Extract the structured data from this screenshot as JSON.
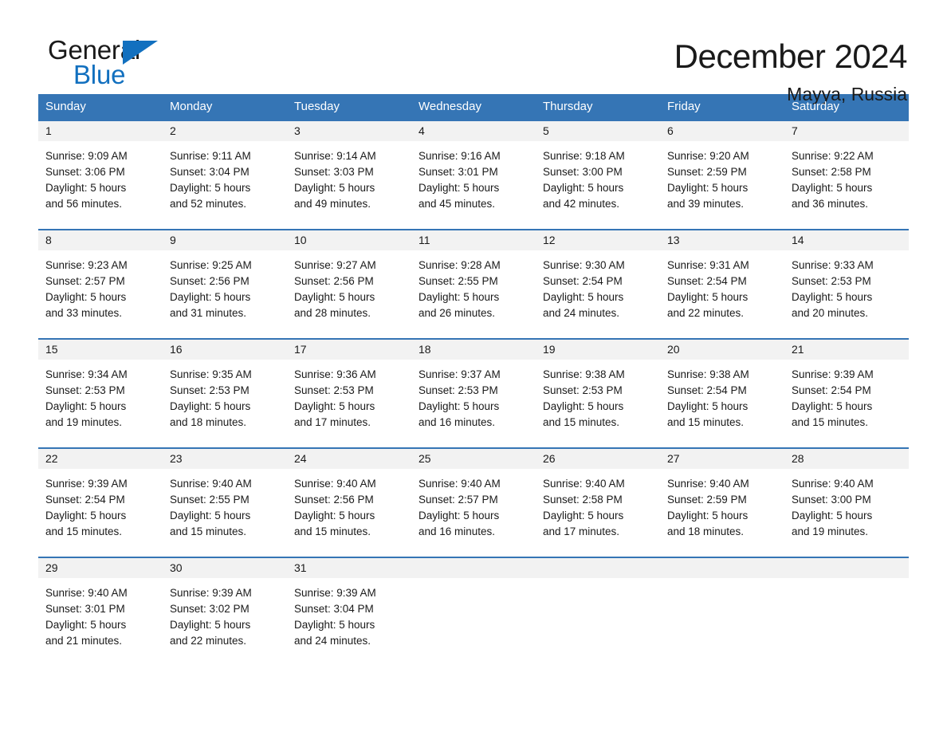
{
  "brand": {
    "name_part1": "General",
    "name_part2": "Blue",
    "triangle_icon": "brand-triangle-icon",
    "colors": {
      "black": "#1a1a1a",
      "blue": "#1270bf"
    }
  },
  "header": {
    "title": "December 2024",
    "location": "Mayya, Russia"
  },
  "colors": {
    "header_blue": "#3575b5",
    "daynum_band": "#f2f2f2",
    "text": "#1a1a1a",
    "header_text": "#ffffff"
  },
  "weekdays": [
    "Sunday",
    "Monday",
    "Tuesday",
    "Wednesday",
    "Thursday",
    "Friday",
    "Saturday"
  ],
  "weeks": [
    [
      {
        "day": "1",
        "sunrise": "Sunrise: 9:09 AM",
        "sunset": "Sunset: 3:06 PM",
        "daylight1": "Daylight: 5 hours",
        "daylight2": "and 56 minutes."
      },
      {
        "day": "2",
        "sunrise": "Sunrise: 9:11 AM",
        "sunset": "Sunset: 3:04 PM",
        "daylight1": "Daylight: 5 hours",
        "daylight2": "and 52 minutes."
      },
      {
        "day": "3",
        "sunrise": "Sunrise: 9:14 AM",
        "sunset": "Sunset: 3:03 PM",
        "daylight1": "Daylight: 5 hours",
        "daylight2": "and 49 minutes."
      },
      {
        "day": "4",
        "sunrise": "Sunrise: 9:16 AM",
        "sunset": "Sunset: 3:01 PM",
        "daylight1": "Daylight: 5 hours",
        "daylight2": "and 45 minutes."
      },
      {
        "day": "5",
        "sunrise": "Sunrise: 9:18 AM",
        "sunset": "Sunset: 3:00 PM",
        "daylight1": "Daylight: 5 hours",
        "daylight2": "and 42 minutes."
      },
      {
        "day": "6",
        "sunrise": "Sunrise: 9:20 AM",
        "sunset": "Sunset: 2:59 PM",
        "daylight1": "Daylight: 5 hours",
        "daylight2": "and 39 minutes."
      },
      {
        "day": "7",
        "sunrise": "Sunrise: 9:22 AM",
        "sunset": "Sunset: 2:58 PM",
        "daylight1": "Daylight: 5 hours",
        "daylight2": "and 36 minutes."
      }
    ],
    [
      {
        "day": "8",
        "sunrise": "Sunrise: 9:23 AM",
        "sunset": "Sunset: 2:57 PM",
        "daylight1": "Daylight: 5 hours",
        "daylight2": "and 33 minutes."
      },
      {
        "day": "9",
        "sunrise": "Sunrise: 9:25 AM",
        "sunset": "Sunset: 2:56 PM",
        "daylight1": "Daylight: 5 hours",
        "daylight2": "and 31 minutes."
      },
      {
        "day": "10",
        "sunrise": "Sunrise: 9:27 AM",
        "sunset": "Sunset: 2:56 PM",
        "daylight1": "Daylight: 5 hours",
        "daylight2": "and 28 minutes."
      },
      {
        "day": "11",
        "sunrise": "Sunrise: 9:28 AM",
        "sunset": "Sunset: 2:55 PM",
        "daylight1": "Daylight: 5 hours",
        "daylight2": "and 26 minutes."
      },
      {
        "day": "12",
        "sunrise": "Sunrise: 9:30 AM",
        "sunset": "Sunset: 2:54 PM",
        "daylight1": "Daylight: 5 hours",
        "daylight2": "and 24 minutes."
      },
      {
        "day": "13",
        "sunrise": "Sunrise: 9:31 AM",
        "sunset": "Sunset: 2:54 PM",
        "daylight1": "Daylight: 5 hours",
        "daylight2": "and 22 minutes."
      },
      {
        "day": "14",
        "sunrise": "Sunrise: 9:33 AM",
        "sunset": "Sunset: 2:53 PM",
        "daylight1": "Daylight: 5 hours",
        "daylight2": "and 20 minutes."
      }
    ],
    [
      {
        "day": "15",
        "sunrise": "Sunrise: 9:34 AM",
        "sunset": "Sunset: 2:53 PM",
        "daylight1": "Daylight: 5 hours",
        "daylight2": "and 19 minutes."
      },
      {
        "day": "16",
        "sunrise": "Sunrise: 9:35 AM",
        "sunset": "Sunset: 2:53 PM",
        "daylight1": "Daylight: 5 hours",
        "daylight2": "and 18 minutes."
      },
      {
        "day": "17",
        "sunrise": "Sunrise: 9:36 AM",
        "sunset": "Sunset: 2:53 PM",
        "daylight1": "Daylight: 5 hours",
        "daylight2": "and 17 minutes."
      },
      {
        "day": "18",
        "sunrise": "Sunrise: 9:37 AM",
        "sunset": "Sunset: 2:53 PM",
        "daylight1": "Daylight: 5 hours",
        "daylight2": "and 16 minutes."
      },
      {
        "day": "19",
        "sunrise": "Sunrise: 9:38 AM",
        "sunset": "Sunset: 2:53 PM",
        "daylight1": "Daylight: 5 hours",
        "daylight2": "and 15 minutes."
      },
      {
        "day": "20",
        "sunrise": "Sunrise: 9:38 AM",
        "sunset": "Sunset: 2:54 PM",
        "daylight1": "Daylight: 5 hours",
        "daylight2": "and 15 minutes."
      },
      {
        "day": "21",
        "sunrise": "Sunrise: 9:39 AM",
        "sunset": "Sunset: 2:54 PM",
        "daylight1": "Daylight: 5 hours",
        "daylight2": "and 15 minutes."
      }
    ],
    [
      {
        "day": "22",
        "sunrise": "Sunrise: 9:39 AM",
        "sunset": "Sunset: 2:54 PM",
        "daylight1": "Daylight: 5 hours",
        "daylight2": "and 15 minutes."
      },
      {
        "day": "23",
        "sunrise": "Sunrise: 9:40 AM",
        "sunset": "Sunset: 2:55 PM",
        "daylight1": "Daylight: 5 hours",
        "daylight2": "and 15 minutes."
      },
      {
        "day": "24",
        "sunrise": "Sunrise: 9:40 AM",
        "sunset": "Sunset: 2:56 PM",
        "daylight1": "Daylight: 5 hours",
        "daylight2": "and 15 minutes."
      },
      {
        "day": "25",
        "sunrise": "Sunrise: 9:40 AM",
        "sunset": "Sunset: 2:57 PM",
        "daylight1": "Daylight: 5 hours",
        "daylight2": "and 16 minutes."
      },
      {
        "day": "26",
        "sunrise": "Sunrise: 9:40 AM",
        "sunset": "Sunset: 2:58 PM",
        "daylight1": "Daylight: 5 hours",
        "daylight2": "and 17 minutes."
      },
      {
        "day": "27",
        "sunrise": "Sunrise: 9:40 AM",
        "sunset": "Sunset: 2:59 PM",
        "daylight1": "Daylight: 5 hours",
        "daylight2": "and 18 minutes."
      },
      {
        "day": "28",
        "sunrise": "Sunrise: 9:40 AM",
        "sunset": "Sunset: 3:00 PM",
        "daylight1": "Daylight: 5 hours",
        "daylight2": "and 19 minutes."
      }
    ],
    [
      {
        "day": "29",
        "sunrise": "Sunrise: 9:40 AM",
        "sunset": "Sunset: 3:01 PM",
        "daylight1": "Daylight: 5 hours",
        "daylight2": "and 21 minutes."
      },
      {
        "day": "30",
        "sunrise": "Sunrise: 9:39 AM",
        "sunset": "Sunset: 3:02 PM",
        "daylight1": "Daylight: 5 hours",
        "daylight2": "and 22 minutes."
      },
      {
        "day": "31",
        "sunrise": "Sunrise: 9:39 AM",
        "sunset": "Sunset: 3:04 PM",
        "daylight1": "Daylight: 5 hours",
        "daylight2": "and 24 minutes."
      },
      {
        "day": "",
        "sunrise": "",
        "sunset": "",
        "daylight1": "",
        "daylight2": ""
      },
      {
        "day": "",
        "sunrise": "",
        "sunset": "",
        "daylight1": "",
        "daylight2": ""
      },
      {
        "day": "",
        "sunrise": "",
        "sunset": "",
        "daylight1": "",
        "daylight2": ""
      },
      {
        "day": "",
        "sunrise": "",
        "sunset": "",
        "daylight1": "",
        "daylight2": ""
      }
    ]
  ]
}
